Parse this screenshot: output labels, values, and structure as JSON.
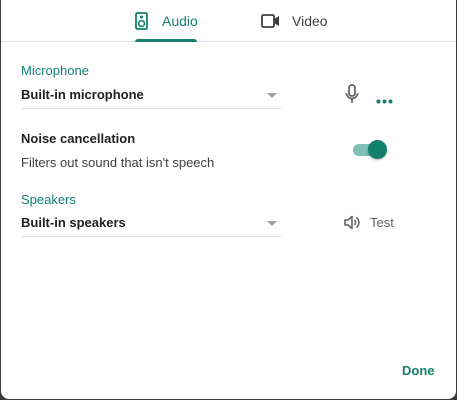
{
  "tabs": [
    {
      "label": "Audio",
      "icon": "speaker-icon",
      "selected": true
    },
    {
      "label": "Video",
      "icon": "video-camera-icon",
      "selected": false
    }
  ],
  "microphone": {
    "section_label": "Microphone",
    "selected_device": "Built-in microphone",
    "icon": "microphone-icon",
    "more_icon": "more-horizontal-icon"
  },
  "noise_cancellation": {
    "title": "Noise cancellation",
    "description": "Filters out sound that isn't speech",
    "enabled": true
  },
  "speakers": {
    "section_label": "Speakers",
    "selected_device": "Built-in speakers",
    "test_label": "Test",
    "test_icon": "speaker-volume-icon"
  },
  "footer": {
    "done_label": "Done"
  },
  "colors": {
    "accent": "#137f6d",
    "toggle_track": "#7fbfb5",
    "text": "#202124",
    "muted": "#5f6368"
  }
}
